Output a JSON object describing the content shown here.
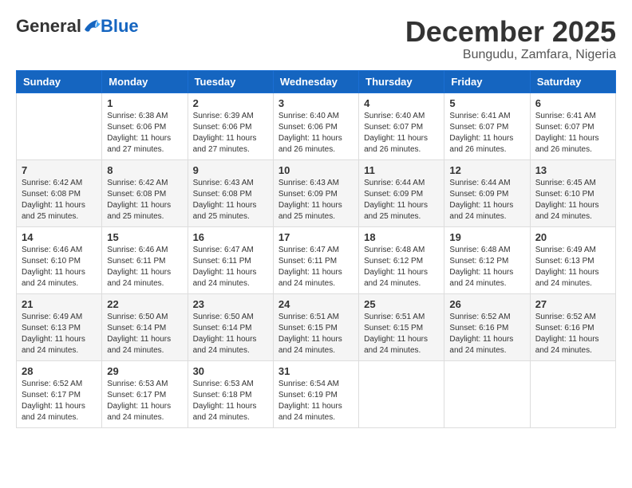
{
  "logo": {
    "general": "General",
    "blue": "Blue"
  },
  "title": {
    "month": "December 2025",
    "location": "Bungudu, Zamfara, Nigeria"
  },
  "headers": [
    "Sunday",
    "Monday",
    "Tuesday",
    "Wednesday",
    "Thursday",
    "Friday",
    "Saturday"
  ],
  "weeks": [
    [
      {
        "day": "",
        "info": ""
      },
      {
        "day": "1",
        "sunrise": "Sunrise: 6:38 AM",
        "sunset": "Sunset: 6:06 PM",
        "daylight": "Daylight: 11 hours and 27 minutes."
      },
      {
        "day": "2",
        "sunrise": "Sunrise: 6:39 AM",
        "sunset": "Sunset: 6:06 PM",
        "daylight": "Daylight: 11 hours and 27 minutes."
      },
      {
        "day": "3",
        "sunrise": "Sunrise: 6:40 AM",
        "sunset": "Sunset: 6:06 PM",
        "daylight": "Daylight: 11 hours and 26 minutes."
      },
      {
        "day": "4",
        "sunrise": "Sunrise: 6:40 AM",
        "sunset": "Sunset: 6:07 PM",
        "daylight": "Daylight: 11 hours and 26 minutes."
      },
      {
        "day": "5",
        "sunrise": "Sunrise: 6:41 AM",
        "sunset": "Sunset: 6:07 PM",
        "daylight": "Daylight: 11 hours and 26 minutes."
      },
      {
        "day": "6",
        "sunrise": "Sunrise: 6:41 AM",
        "sunset": "Sunset: 6:07 PM",
        "daylight": "Daylight: 11 hours and 26 minutes."
      }
    ],
    [
      {
        "day": "7",
        "sunrise": "Sunrise: 6:42 AM",
        "sunset": "Sunset: 6:08 PM",
        "daylight": "Daylight: 11 hours and 25 minutes."
      },
      {
        "day": "8",
        "sunrise": "Sunrise: 6:42 AM",
        "sunset": "Sunset: 6:08 PM",
        "daylight": "Daylight: 11 hours and 25 minutes."
      },
      {
        "day": "9",
        "sunrise": "Sunrise: 6:43 AM",
        "sunset": "Sunset: 6:08 PM",
        "daylight": "Daylight: 11 hours and 25 minutes."
      },
      {
        "day": "10",
        "sunrise": "Sunrise: 6:43 AM",
        "sunset": "Sunset: 6:09 PM",
        "daylight": "Daylight: 11 hours and 25 minutes."
      },
      {
        "day": "11",
        "sunrise": "Sunrise: 6:44 AM",
        "sunset": "Sunset: 6:09 PM",
        "daylight": "Daylight: 11 hours and 25 minutes."
      },
      {
        "day": "12",
        "sunrise": "Sunrise: 6:44 AM",
        "sunset": "Sunset: 6:09 PM",
        "daylight": "Daylight: 11 hours and 24 minutes."
      },
      {
        "day": "13",
        "sunrise": "Sunrise: 6:45 AM",
        "sunset": "Sunset: 6:10 PM",
        "daylight": "Daylight: 11 hours and 24 minutes."
      }
    ],
    [
      {
        "day": "14",
        "sunrise": "Sunrise: 6:46 AM",
        "sunset": "Sunset: 6:10 PM",
        "daylight": "Daylight: 11 hours and 24 minutes."
      },
      {
        "day": "15",
        "sunrise": "Sunrise: 6:46 AM",
        "sunset": "Sunset: 6:11 PM",
        "daylight": "Daylight: 11 hours and 24 minutes."
      },
      {
        "day": "16",
        "sunrise": "Sunrise: 6:47 AM",
        "sunset": "Sunset: 6:11 PM",
        "daylight": "Daylight: 11 hours and 24 minutes."
      },
      {
        "day": "17",
        "sunrise": "Sunrise: 6:47 AM",
        "sunset": "Sunset: 6:11 PM",
        "daylight": "Daylight: 11 hours and 24 minutes."
      },
      {
        "day": "18",
        "sunrise": "Sunrise: 6:48 AM",
        "sunset": "Sunset: 6:12 PM",
        "daylight": "Daylight: 11 hours and 24 minutes."
      },
      {
        "day": "19",
        "sunrise": "Sunrise: 6:48 AM",
        "sunset": "Sunset: 6:12 PM",
        "daylight": "Daylight: 11 hours and 24 minutes."
      },
      {
        "day": "20",
        "sunrise": "Sunrise: 6:49 AM",
        "sunset": "Sunset: 6:13 PM",
        "daylight": "Daylight: 11 hours and 24 minutes."
      }
    ],
    [
      {
        "day": "21",
        "sunrise": "Sunrise: 6:49 AM",
        "sunset": "Sunset: 6:13 PM",
        "daylight": "Daylight: 11 hours and 24 minutes."
      },
      {
        "day": "22",
        "sunrise": "Sunrise: 6:50 AM",
        "sunset": "Sunset: 6:14 PM",
        "daylight": "Daylight: 11 hours and 24 minutes."
      },
      {
        "day": "23",
        "sunrise": "Sunrise: 6:50 AM",
        "sunset": "Sunset: 6:14 PM",
        "daylight": "Daylight: 11 hours and 24 minutes."
      },
      {
        "day": "24",
        "sunrise": "Sunrise: 6:51 AM",
        "sunset": "Sunset: 6:15 PM",
        "daylight": "Daylight: 11 hours and 24 minutes."
      },
      {
        "day": "25",
        "sunrise": "Sunrise: 6:51 AM",
        "sunset": "Sunset: 6:15 PM",
        "daylight": "Daylight: 11 hours and 24 minutes."
      },
      {
        "day": "26",
        "sunrise": "Sunrise: 6:52 AM",
        "sunset": "Sunset: 6:16 PM",
        "daylight": "Daylight: 11 hours and 24 minutes."
      },
      {
        "day": "27",
        "sunrise": "Sunrise: 6:52 AM",
        "sunset": "Sunset: 6:16 PM",
        "daylight": "Daylight: 11 hours and 24 minutes."
      }
    ],
    [
      {
        "day": "28",
        "sunrise": "Sunrise: 6:52 AM",
        "sunset": "Sunset: 6:17 PM",
        "daylight": "Daylight: 11 hours and 24 minutes."
      },
      {
        "day": "29",
        "sunrise": "Sunrise: 6:53 AM",
        "sunset": "Sunset: 6:17 PM",
        "daylight": "Daylight: 11 hours and 24 minutes."
      },
      {
        "day": "30",
        "sunrise": "Sunrise: 6:53 AM",
        "sunset": "Sunset: 6:18 PM",
        "daylight": "Daylight: 11 hours and 24 minutes."
      },
      {
        "day": "31",
        "sunrise": "Sunrise: 6:54 AM",
        "sunset": "Sunset: 6:19 PM",
        "daylight": "Daylight: 11 hours and 24 minutes."
      },
      {
        "day": "",
        "info": ""
      },
      {
        "day": "",
        "info": ""
      },
      {
        "day": "",
        "info": ""
      }
    ]
  ]
}
